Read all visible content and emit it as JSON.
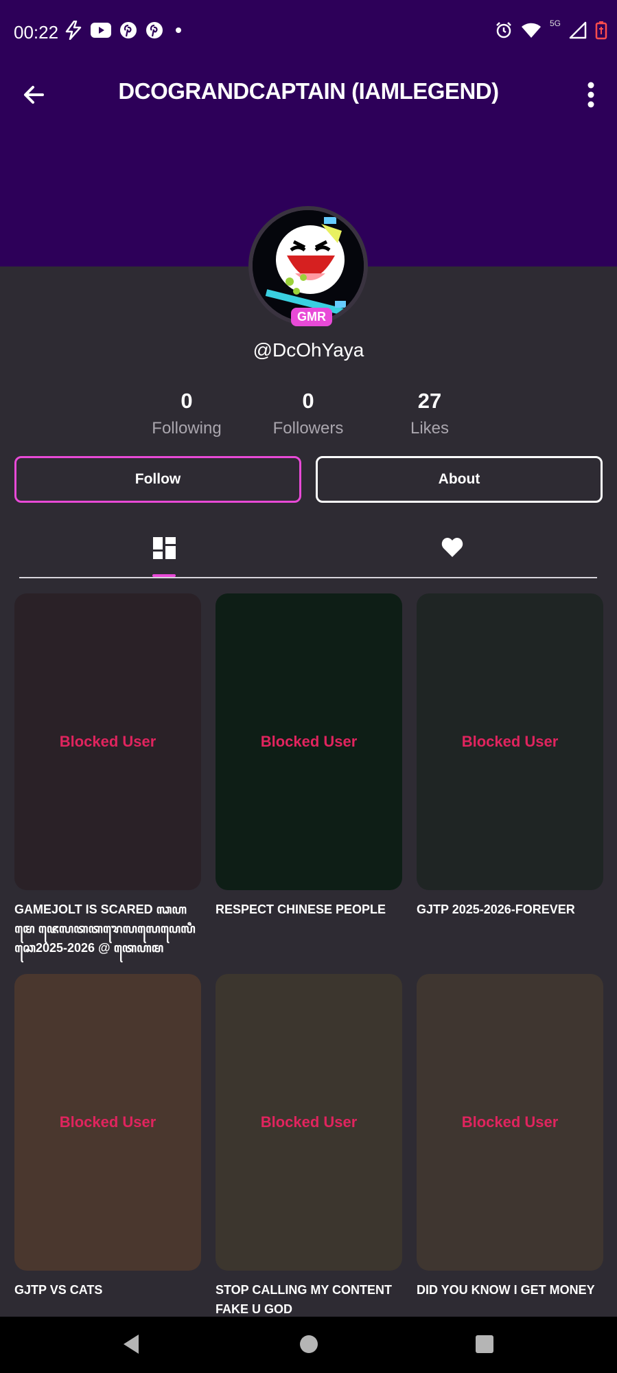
{
  "status_bar": {
    "time": "00:22",
    "left_icons": [
      "bolt-icon",
      "youtube-icon",
      "pinterest-icon",
      "pinterest-icon",
      "dot-icon"
    ],
    "right_icons": [
      "alarm-icon",
      "wifi-icon",
      "signal-icon",
      "battery-icon"
    ],
    "network": "5G"
  },
  "header": {
    "title": "DCOGRANDCAPTAIN (IAMLEGEND)",
    "back_icon": "arrow-back-icon",
    "menu_icon": "more-vert-icon",
    "banner_color": "#2d0059"
  },
  "profile": {
    "badge": "GMR",
    "handle": "@DcOhYaya",
    "accent_color": "#e84ad7"
  },
  "stats": [
    {
      "value": "0",
      "label": "Following"
    },
    {
      "value": "0",
      "label": "Followers"
    },
    {
      "value": "27",
      "label": "Likes"
    }
  ],
  "buttons": {
    "follow": "Follow",
    "about": "About"
  },
  "tabs": [
    {
      "icon": "grid-icon",
      "active": true
    },
    {
      "icon": "heart-icon",
      "active": false
    }
  ],
  "posts": [
    {
      "label": "Blocked User",
      "caption": "GAMEJOLT IS SCARED ꦓꦲꦩꦺ ꦗꦺꦭꦠꦠꦫꦺꦭꦭꦺꦥꦺꦭꦶꦕꦺ2025-2026 @ ꦠꦺꦲꦩ",
      "bg": "#2a2127",
      "label_color": "#e0245e"
    },
    {
      "label": "Blocked User",
      "caption": "RESPECT CHINESE PEOPLE",
      "bg": "#0e1e16",
      "label_color": "#e0245e"
    },
    {
      "label": "Blocked User",
      "caption": "GJTP 2025-2026-FOREVER",
      "bg": "#1f2524",
      "label_color": "#e0245e"
    },
    {
      "label": "Blocked User",
      "caption": "GJTP VS CATS",
      "bg": "#4a372e",
      "label_color": "#e0245e"
    },
    {
      "label": "Blocked User",
      "caption": "STOP CALLING MY CONTENT FAKE U GOD",
      "bg": "#3c362e",
      "label_color": "#e0245e"
    },
    {
      "label": "Blocked User",
      "caption": "DID YOU KNOW I GET MONEY",
      "bg": "#3f3630",
      "label_color": "#e0245e"
    }
  ],
  "nav": [
    "nav-back-icon",
    "nav-home-icon",
    "nav-recents-icon"
  ]
}
